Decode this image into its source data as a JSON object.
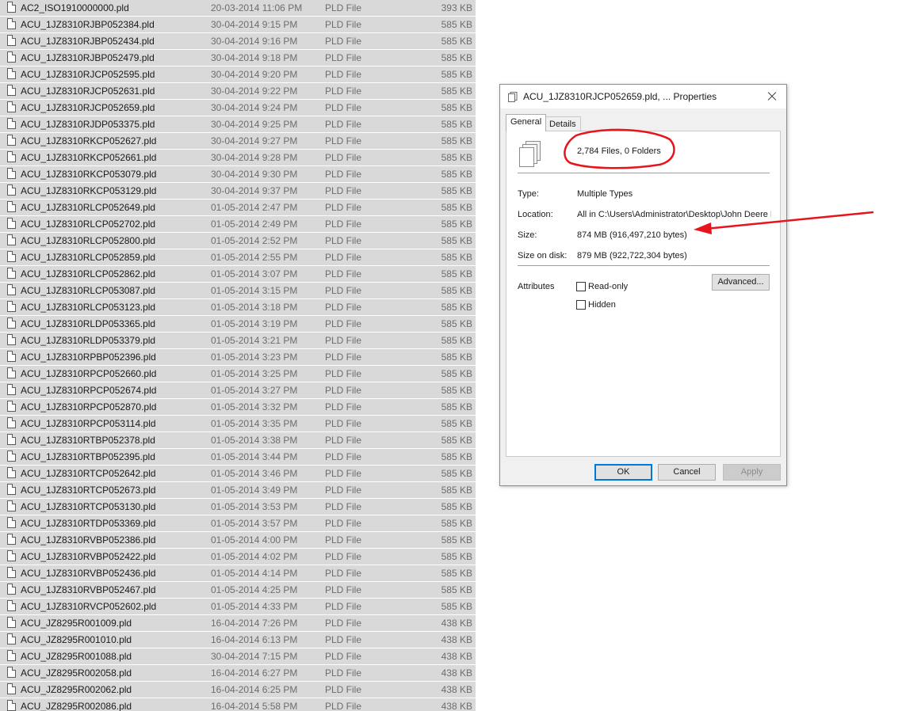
{
  "files": [
    {
      "name": "AC2_ISO1910000000.pld",
      "date": "20-03-2014 11:06 PM",
      "type": "PLD File",
      "size": "393 KB"
    },
    {
      "name": "ACU_1JZ8310RJBP052384.pld",
      "date": "30-04-2014 9:15 PM",
      "type": "PLD File",
      "size": "585 KB"
    },
    {
      "name": "ACU_1JZ8310RJBP052434.pld",
      "date": "30-04-2014 9:16 PM",
      "type": "PLD File",
      "size": "585 KB"
    },
    {
      "name": "ACU_1JZ8310RJBP052479.pld",
      "date": "30-04-2014 9:18 PM",
      "type": "PLD File",
      "size": "585 KB"
    },
    {
      "name": "ACU_1JZ8310RJCP052595.pld",
      "date": "30-04-2014 9:20 PM",
      "type": "PLD File",
      "size": "585 KB"
    },
    {
      "name": "ACU_1JZ8310RJCP052631.pld",
      "date": "30-04-2014 9:22 PM",
      "type": "PLD File",
      "size": "585 KB"
    },
    {
      "name": "ACU_1JZ8310RJCP052659.pld",
      "date": "30-04-2014 9:24 PM",
      "type": "PLD File",
      "size": "585 KB"
    },
    {
      "name": "ACU_1JZ8310RJDP053375.pld",
      "date": "30-04-2014 9:25 PM",
      "type": "PLD File",
      "size": "585 KB"
    },
    {
      "name": "ACU_1JZ8310RKCP052627.pld",
      "date": "30-04-2014 9:27 PM",
      "type": "PLD File",
      "size": "585 KB"
    },
    {
      "name": "ACU_1JZ8310RKCP052661.pld",
      "date": "30-04-2014 9:28 PM",
      "type": "PLD File",
      "size": "585 KB"
    },
    {
      "name": "ACU_1JZ8310RKCP053079.pld",
      "date": "30-04-2014 9:30 PM",
      "type": "PLD File",
      "size": "585 KB"
    },
    {
      "name": "ACU_1JZ8310RKCP053129.pld",
      "date": "30-04-2014 9:37 PM",
      "type": "PLD File",
      "size": "585 KB"
    },
    {
      "name": "ACU_1JZ8310RLCP052649.pld",
      "date": "01-05-2014 2:47 PM",
      "type": "PLD File",
      "size": "585 KB"
    },
    {
      "name": "ACU_1JZ8310RLCP052702.pld",
      "date": "01-05-2014 2:49 PM",
      "type": "PLD File",
      "size": "585 KB"
    },
    {
      "name": "ACU_1JZ8310RLCP052800.pld",
      "date": "01-05-2014 2:52 PM",
      "type": "PLD File",
      "size": "585 KB"
    },
    {
      "name": "ACU_1JZ8310RLCP052859.pld",
      "date": "01-05-2014 2:55 PM",
      "type": "PLD File",
      "size": "585 KB"
    },
    {
      "name": "ACU_1JZ8310RLCP052862.pld",
      "date": "01-05-2014 3:07 PM",
      "type": "PLD File",
      "size": "585 KB"
    },
    {
      "name": "ACU_1JZ8310RLCP053087.pld",
      "date": "01-05-2014 3:15 PM",
      "type": "PLD File",
      "size": "585 KB"
    },
    {
      "name": "ACU_1JZ8310RLCP053123.pld",
      "date": "01-05-2014 3:18 PM",
      "type": "PLD File",
      "size": "585 KB"
    },
    {
      "name": "ACU_1JZ8310RLDP053365.pld",
      "date": "01-05-2014 3:19 PM",
      "type": "PLD File",
      "size": "585 KB"
    },
    {
      "name": "ACU_1JZ8310RLDP053379.pld",
      "date": "01-05-2014 3:21 PM",
      "type": "PLD File",
      "size": "585 KB"
    },
    {
      "name": "ACU_1JZ8310RPBP052396.pld",
      "date": "01-05-2014 3:23 PM",
      "type": "PLD File",
      "size": "585 KB"
    },
    {
      "name": "ACU_1JZ8310RPCP052660.pld",
      "date": "01-05-2014 3:25 PM",
      "type": "PLD File",
      "size": "585 KB"
    },
    {
      "name": "ACU_1JZ8310RPCP052674.pld",
      "date": "01-05-2014 3:27 PM",
      "type": "PLD File",
      "size": "585 KB"
    },
    {
      "name": "ACU_1JZ8310RPCP052870.pld",
      "date": "01-05-2014 3:32 PM",
      "type": "PLD File",
      "size": "585 KB"
    },
    {
      "name": "ACU_1JZ8310RPCP053114.pld",
      "date": "01-05-2014 3:35 PM",
      "type": "PLD File",
      "size": "585 KB"
    },
    {
      "name": "ACU_1JZ8310RTBP052378.pld",
      "date": "01-05-2014 3:38 PM",
      "type": "PLD File",
      "size": "585 KB"
    },
    {
      "name": "ACU_1JZ8310RTBP052395.pld",
      "date": "01-05-2014 3:44 PM",
      "type": "PLD File",
      "size": "585 KB"
    },
    {
      "name": "ACU_1JZ8310RTCP052642.pld",
      "date": "01-05-2014 3:46 PM",
      "type": "PLD File",
      "size": "585 KB"
    },
    {
      "name": "ACU_1JZ8310RTCP052673.pld",
      "date": "01-05-2014 3:49 PM",
      "type": "PLD File",
      "size": "585 KB"
    },
    {
      "name": "ACU_1JZ8310RTCP053130.pld",
      "date": "01-05-2014 3:53 PM",
      "type": "PLD File",
      "size": "585 KB"
    },
    {
      "name": "ACU_1JZ8310RTDP053369.pld",
      "date": "01-05-2014 3:57 PM",
      "type": "PLD File",
      "size": "585 KB"
    },
    {
      "name": "ACU_1JZ8310RVBP052386.pld",
      "date": "01-05-2014 4:00 PM",
      "type": "PLD File",
      "size": "585 KB"
    },
    {
      "name": "ACU_1JZ8310RVBP052422.pld",
      "date": "01-05-2014 4:02 PM",
      "type": "PLD File",
      "size": "585 KB"
    },
    {
      "name": "ACU_1JZ8310RVBP052436.pld",
      "date": "01-05-2014 4:14 PM",
      "type": "PLD File",
      "size": "585 KB"
    },
    {
      "name": "ACU_1JZ8310RVBP052467.pld",
      "date": "01-05-2014 4:25 PM",
      "type": "PLD File",
      "size": "585 KB"
    },
    {
      "name": "ACU_1JZ8310RVCP052602.pld",
      "date": "01-05-2014 4:33 PM",
      "type": "PLD File",
      "size": "585 KB"
    },
    {
      "name": "ACU_JZ8295R001009.pld",
      "date": "16-04-2014 7:26 PM",
      "type": "PLD File",
      "size": "438 KB"
    },
    {
      "name": "ACU_JZ8295R001010.pld",
      "date": "16-04-2014 6:13 PM",
      "type": "PLD File",
      "size": "438 KB"
    },
    {
      "name": "ACU_JZ8295R001088.pld",
      "date": "30-04-2014 7:15 PM",
      "type": "PLD File",
      "size": "438 KB"
    },
    {
      "name": "ACU_JZ8295R002058.pld",
      "date": "16-04-2014 6:27 PM",
      "type": "PLD File",
      "size": "438 KB"
    },
    {
      "name": "ACU_JZ8295R002062.pld",
      "date": "16-04-2014 6:25 PM",
      "type": "PLD File",
      "size": "438 KB"
    },
    {
      "name": "ACU_JZ8295R002086.pld",
      "date": "16-04-2014 5:58 PM",
      "type": "PLD File",
      "size": "438 KB"
    }
  ],
  "dialog": {
    "title": "ACU_1JZ8310RJCP052659.pld, ... Properties",
    "tabs": {
      "general": "General",
      "details": "Details"
    },
    "summary": "2,784 Files, 0 Folders",
    "type_label": "Type:",
    "type_value": "Multiple Types",
    "location_label": "Location:",
    "location_value": "All in C:\\Users\\Administrator\\Desktop\\John Deere F",
    "size_label": "Size:",
    "size_value": "874 MB (916,497,210 bytes)",
    "size_on_disk_label": "Size on disk:",
    "size_on_disk_value": "879 MB (922,722,304 bytes)",
    "attributes_label": "Attributes",
    "readonly_label": "Read-only",
    "hidden_label": "Hidden",
    "advanced_label": "Advanced...",
    "ok_label": "OK",
    "cancel_label": "Cancel",
    "apply_label": "Apply"
  },
  "colors": {
    "selection": "#d9d9d9",
    "annotation": "#e8141c",
    "focus": "#0078d7"
  },
  "icons": {
    "file": "file-icon",
    "files": "multiple-files-icon",
    "close": "close-icon",
    "arrow": "red-arrow-annotation"
  }
}
